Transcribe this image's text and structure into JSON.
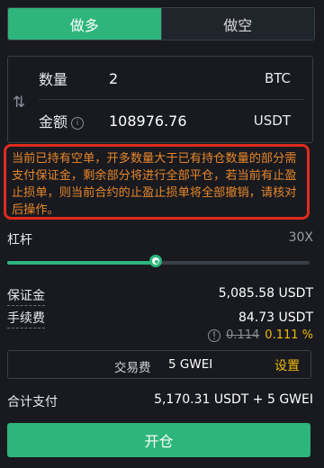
{
  "tabs": {
    "long": "做多",
    "short": "做空",
    "active": "long"
  },
  "form": {
    "quantity_label": "数量",
    "quantity_value": "2",
    "quantity_unit": "BTC",
    "amount_label": "金额",
    "amount_value": "108976.76",
    "amount_unit": "USDT"
  },
  "warning_text": "当前已持有空单，开多数量大于已有持仓数量的部分需支付保证金，剩余部分将进行全部平仓，若当前有止盈止损单，则当前合约的止盈止损单将全部撤销，请核对后操作。",
  "leverage": {
    "label": "杠杆",
    "value": "30X",
    "fraction": 0.49
  },
  "margin": {
    "label": "保证金",
    "value": "5,085.58 USDT"
  },
  "fee": {
    "label": "手续费",
    "value": "84.73 USDT",
    "old_rate": "0.114",
    "new_rate": "0.111 %"
  },
  "gas": {
    "label": "交易费",
    "value": "5 GWEI",
    "setting": "设置"
  },
  "total": {
    "label": "合计支付",
    "value": "5,170.31 USDT + 5 GWEI"
  },
  "submit_label": "开仓",
  "colors": {
    "accent": "#2eb57c",
    "warning": "#e8862a",
    "warning_border": "#e02b1d",
    "highlight": "#f0b90b"
  }
}
